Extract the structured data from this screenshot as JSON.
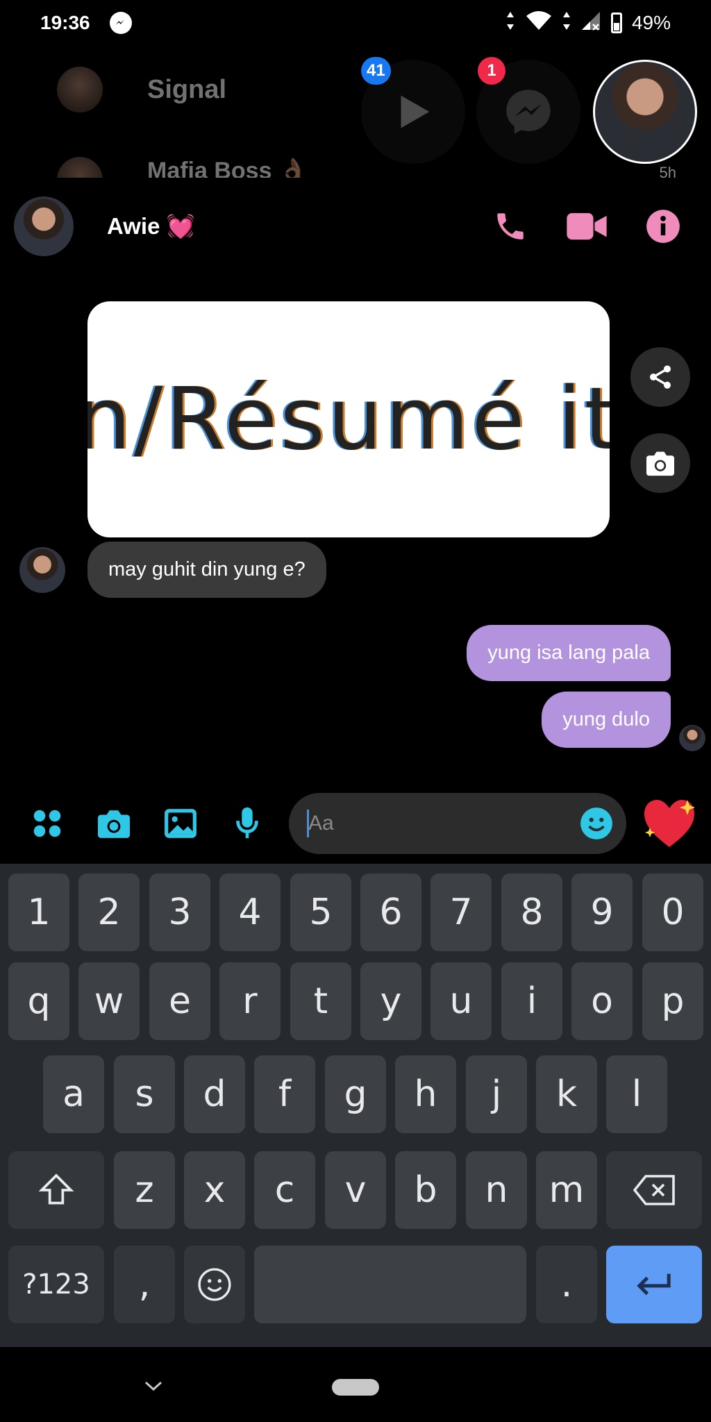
{
  "status_bar": {
    "time": "19:36",
    "battery": "49%"
  },
  "background_chats": {
    "items": [
      {
        "name": "Signal"
      },
      {
        "name": "Mafia Boss 👌🏽"
      }
    ],
    "last_time": "5h",
    "chat_heads": [
      {
        "icon": "play-icon",
        "badge": "41",
        "badge_color": "#1877f2"
      },
      {
        "icon": "messenger-icon",
        "badge": "1",
        "badge_color": "#f02849"
      }
    ]
  },
  "chat": {
    "contact_name": "Awie 💓",
    "accent_color": "#f08cbb",
    "image_message_text": "n/Résumé it",
    "messages": [
      {
        "direction": "in",
        "text": "may guhit din yung e?"
      },
      {
        "direction": "out",
        "text": "yung isa lang pala"
      },
      {
        "direction": "out",
        "text": "yung dulo"
      }
    ],
    "outgoing_bubble_color": "#b493de"
  },
  "composer": {
    "placeholder": "Aa",
    "icon_color": "#2ec7e6"
  },
  "keyboard": {
    "row1": [
      "1",
      "2",
      "3",
      "4",
      "5",
      "6",
      "7",
      "8",
      "9",
      "0"
    ],
    "row2": [
      "q",
      "w",
      "e",
      "r",
      "t",
      "y",
      "u",
      "i",
      "o",
      "p"
    ],
    "row3": [
      "a",
      "s",
      "d",
      "f",
      "g",
      "h",
      "j",
      "k",
      "l"
    ],
    "row4": [
      "z",
      "x",
      "c",
      "v",
      "b",
      "n",
      "m"
    ],
    "symbols_label": "?123",
    "comma": ",",
    "period": "."
  }
}
